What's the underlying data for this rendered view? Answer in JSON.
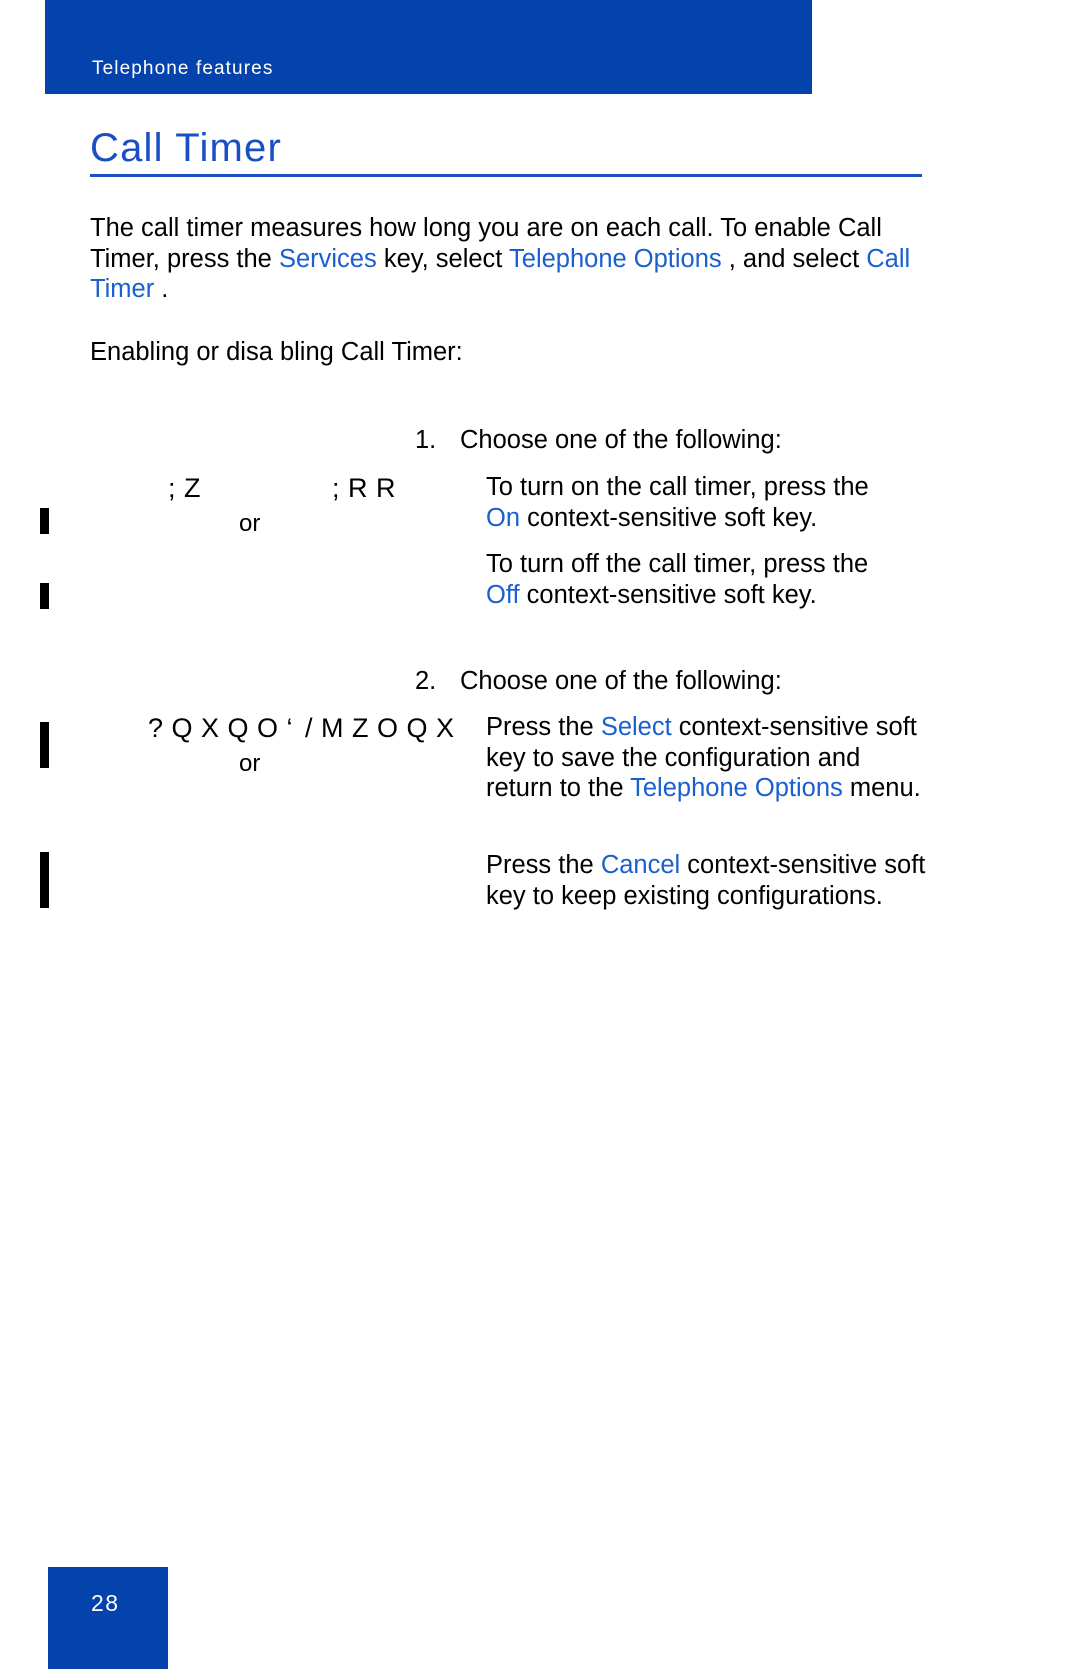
{
  "document": {
    "running_header": "Telephone features",
    "section_title": "Call Timer",
    "page_number": "28"
  },
  "colors": {
    "banner_blue": "#0443ab",
    "title_blue": "#1a4fc4",
    "keyword_blue": "#1a5fd0",
    "body_black": "#000000",
    "page_white": "#ffffff"
  },
  "intro": {
    "part1": "The call timer measures how long you are on each call. To enable Call Timer, press the ",
    "kw_services": "Services",
    "part2": " key, select ",
    "kw_telephone_options": "Telephone Options",
    "part3": " , and select ",
    "kw_call_timer": "Call Timer",
    "part4": " ."
  },
  "enabling_line": "Enabling or disa  bling Call Timer:",
  "steps": [
    {
      "number": "1.",
      "lead": "Choose one of the following:",
      "glyph_left": "; Z",
      "glyph_right": "; R R",
      "or_label": "or",
      "items": [
        {
          "part1": "To turn on the call timer, press the ",
          "keyword": "On",
          "part2": " context-sensitive soft key."
        },
        {
          "part1": "To turn off the call timer, press the ",
          "keyword": "Off",
          "part2": " context-sensitive soft key."
        }
      ]
    },
    {
      "number": "2.",
      "lead": "Choose one of the following:",
      "glyph_left": "? Q X Q O ‘",
      "glyph_right": "/ M Z O Q X",
      "or_label": "or",
      "items": [
        {
          "part1": "Press the  ",
          "keyword": "Select",
          "part2": " context-sensitive soft key to save the configuration and return to the ",
          "keyword2": "Telephone Options",
          "part3": " menu."
        },
        {
          "part1": "Press the  ",
          "keyword": "Cancel",
          "part2": " context-sensitive soft key to keep existing configurations."
        }
      ]
    }
  ]
}
